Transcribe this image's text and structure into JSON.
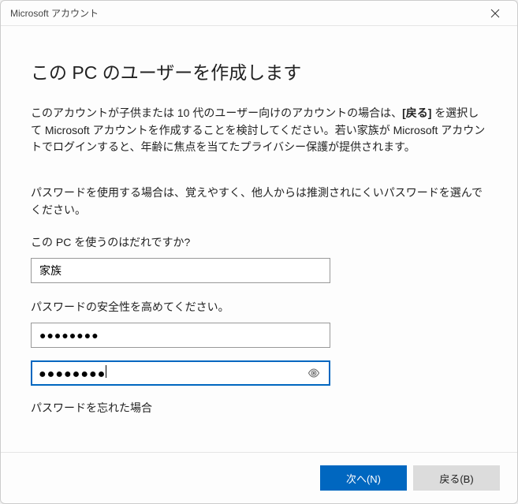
{
  "window": {
    "title": "Microsoft アカウント"
  },
  "main": {
    "heading": "この PC のユーザーを作成します",
    "para1_pre": "このアカウントが子供または 10 代のユーザー向けのアカウントの場合は、",
    "para1_bold": "[戻る]",
    "para1_post": " を選択して Microsoft アカウントを作成することを検討してください。若い家族が Microsoft アカウントでログインすると、年齢に焦点を当てたプライバシー保護が提供されます。",
    "para2": "パスワードを使用する場合は、覚えやすく、他人からは推測されにくいパスワードを選んでください。",
    "username_label": "この PC を使うのはだれですか?",
    "username_value": "家族",
    "password_label": "パスワードの安全性を高めてください。",
    "password_value": "●●●●●●●●",
    "password_confirm_value": "●●●●●●●●",
    "forgot_label": "パスワードを忘れた場合"
  },
  "footer": {
    "next": "次へ(N)",
    "back": "戻る(B)"
  }
}
